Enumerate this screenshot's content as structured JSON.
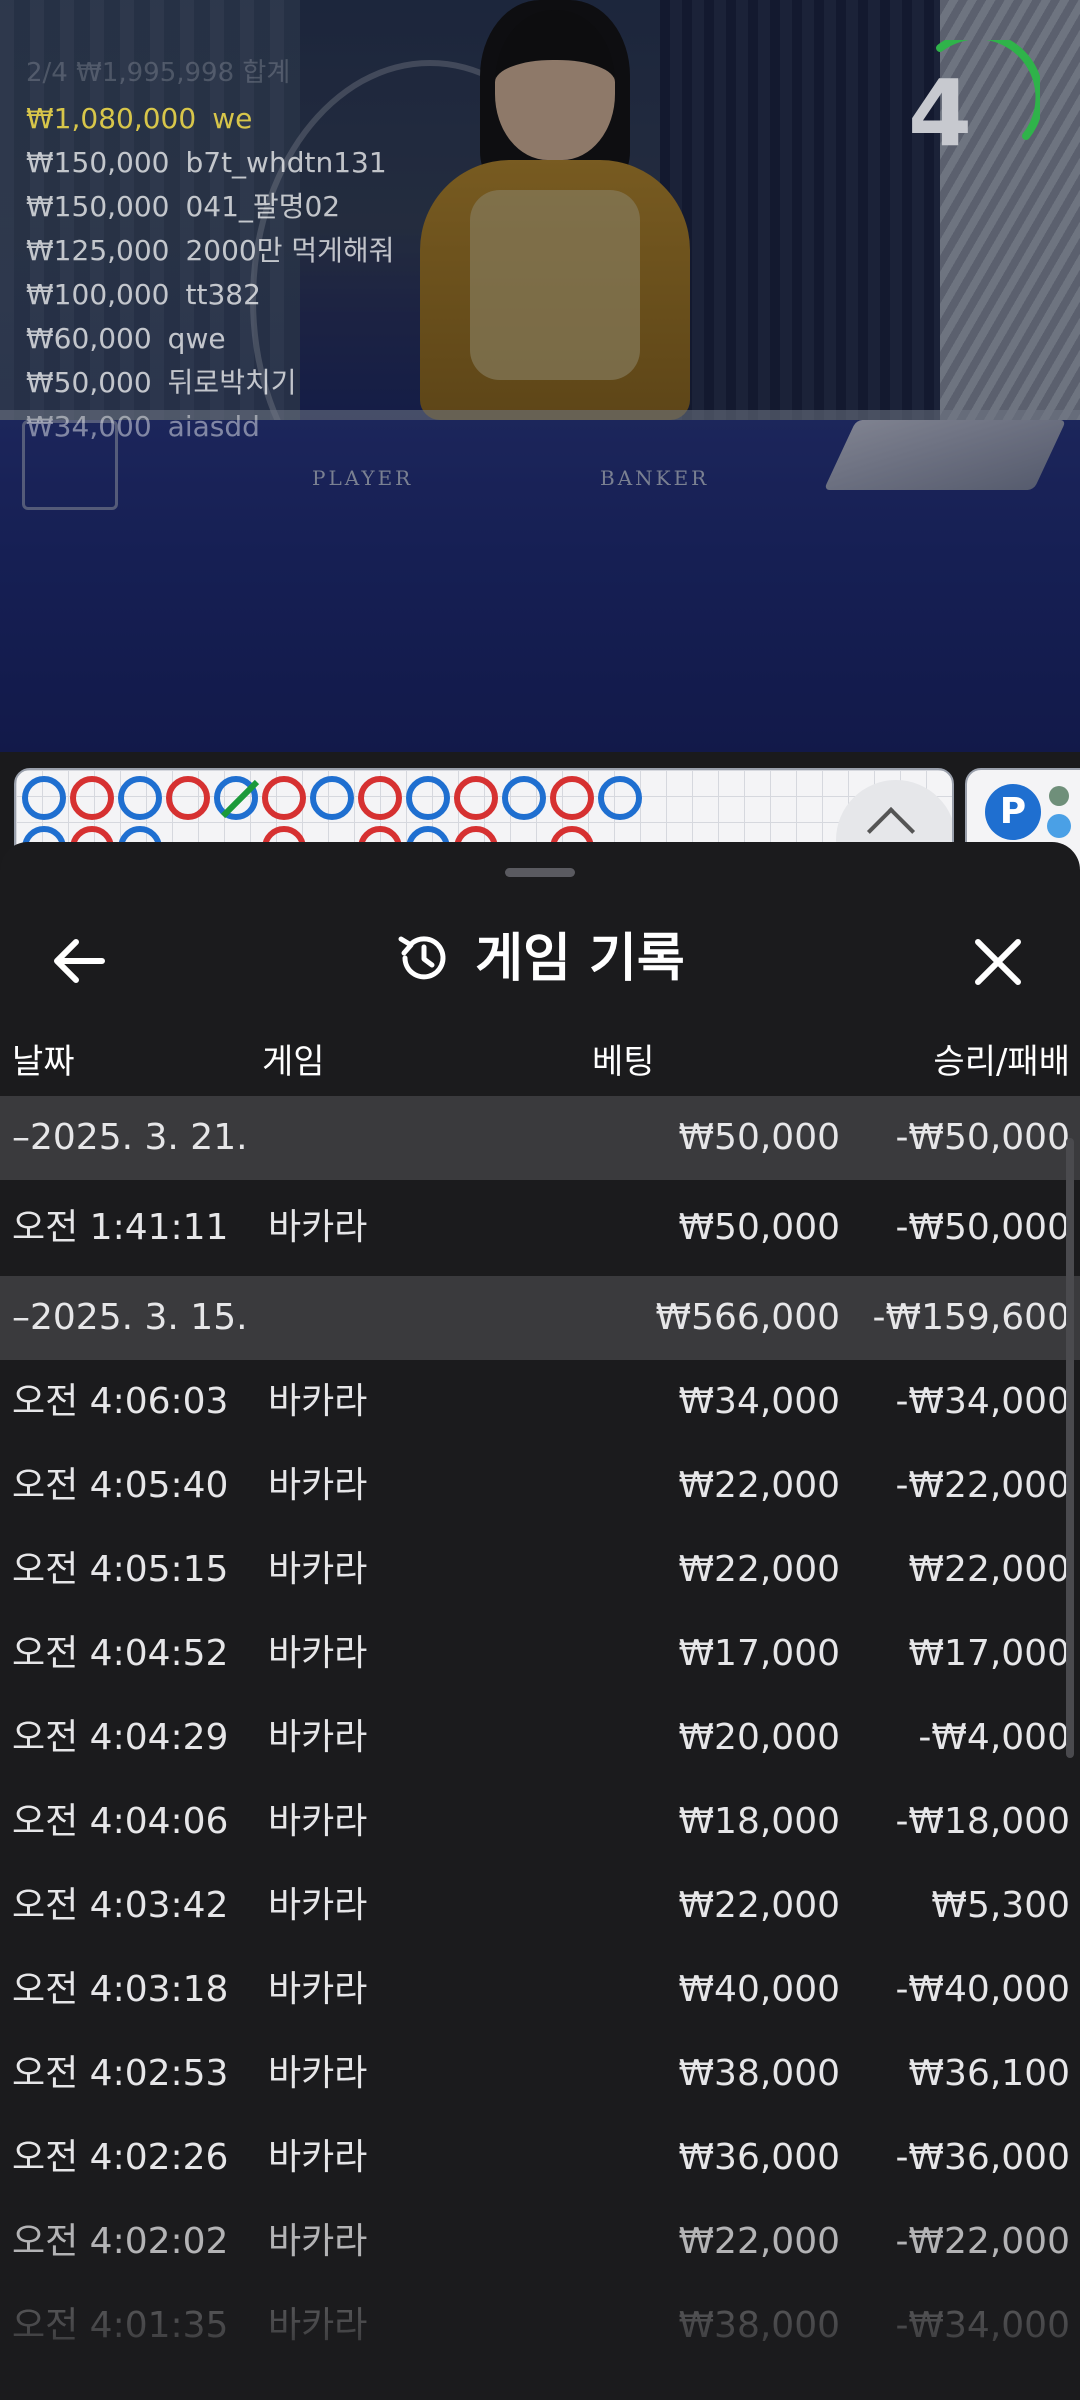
{
  "video": {
    "table_labels": {
      "player": "PLAYER",
      "banker": "BANKER"
    },
    "bets_summary": "2/4  ₩1,995,998  합계",
    "bets": [
      {
        "amount": "₩1,080,000",
        "name": "we",
        "highlight": true
      },
      {
        "amount": "₩150,000",
        "name": "b7t_whdtn131"
      },
      {
        "amount": "₩150,000",
        "name": "041_팔명02"
      },
      {
        "amount": "₩125,000",
        "name": "2000만 먹게해줘"
      },
      {
        "amount": "₩100,000",
        "name": "tt382"
      },
      {
        "amount": "₩60,000",
        "name": "qwe"
      },
      {
        "amount": "₩50,000",
        "name": "뒤로박치기"
      },
      {
        "amount": "₩34,000",
        "name": "aiasdd"
      }
    ],
    "countdown": "4",
    "countdown_color": "#2fb34a"
  },
  "roadmap": {
    "row1": [
      "b",
      "r",
      "b",
      "r",
      "tie",
      "r",
      "b",
      "r",
      "b",
      "r",
      "b",
      "r",
      "b"
    ],
    "row2": [
      "b",
      "r",
      "b",
      "",
      "",
      "r",
      "",
      "r",
      "b",
      "r",
      "",
      "r",
      ""
    ],
    "player_badge": "P"
  },
  "sheet": {
    "title": "게임 기록",
    "columns": {
      "date": "날짜",
      "game": "게임",
      "bet": "베팅",
      "result": "승리/패배"
    },
    "rows": [
      {
        "type": "group",
        "date": "–2025. 3. 21.",
        "bet": "₩50,000",
        "result": "-₩50,000"
      },
      {
        "type": "item",
        "time": "오전 1:41:11",
        "game": "바카라",
        "bet": "₩50,000",
        "result": "-₩50,000"
      },
      {
        "type": "group",
        "date": "–2025. 3. 15.",
        "bet": "₩566,000",
        "result": "-₩159,600"
      },
      {
        "type": "item",
        "time": "오전 4:06:03",
        "game": "바카라",
        "bet": "₩34,000",
        "result": "-₩34,000"
      },
      {
        "type": "item",
        "time": "오전 4:05:40",
        "game": "바카라",
        "bet": "₩22,000",
        "result": "-₩22,000"
      },
      {
        "type": "item",
        "time": "오전 4:05:15",
        "game": "바카라",
        "bet": "₩22,000",
        "result": "₩22,000"
      },
      {
        "type": "item",
        "time": "오전 4:04:52",
        "game": "바카라",
        "bet": "₩17,000",
        "result": "₩17,000"
      },
      {
        "type": "item",
        "time": "오전 4:04:29",
        "game": "바카라",
        "bet": "₩20,000",
        "result": "-₩4,000"
      },
      {
        "type": "item",
        "time": "오전 4:04:06",
        "game": "바카라",
        "bet": "₩18,000",
        "result": "-₩18,000"
      },
      {
        "type": "item",
        "time": "오전 4:03:42",
        "game": "바카라",
        "bet": "₩22,000",
        "result": "₩5,300"
      },
      {
        "type": "item",
        "time": "오전 4:03:18",
        "game": "바카라",
        "bet": "₩40,000",
        "result": "-₩40,000"
      },
      {
        "type": "item",
        "time": "오전 4:02:53",
        "game": "바카라",
        "bet": "₩38,000",
        "result": "₩36,100"
      },
      {
        "type": "item",
        "time": "오전 4:02:26",
        "game": "바카라",
        "bet": "₩36,000",
        "result": "-₩36,000"
      },
      {
        "type": "item",
        "time": "오전 4:02:02",
        "game": "바카라",
        "bet": "₩22,000",
        "result": "-₩22,000"
      },
      {
        "type": "item",
        "time": "오전 4:01:35",
        "game": "바카라",
        "bet": "₩38,000",
        "result": "-₩34,000"
      }
    ]
  },
  "colors": {
    "sheet_bg": "#1b1b1d",
    "group_row_bg": "#3a3a3d",
    "banker_red": "#d63131",
    "player_blue": "#1f6fd0",
    "tie_green": "#1c9a3a"
  }
}
